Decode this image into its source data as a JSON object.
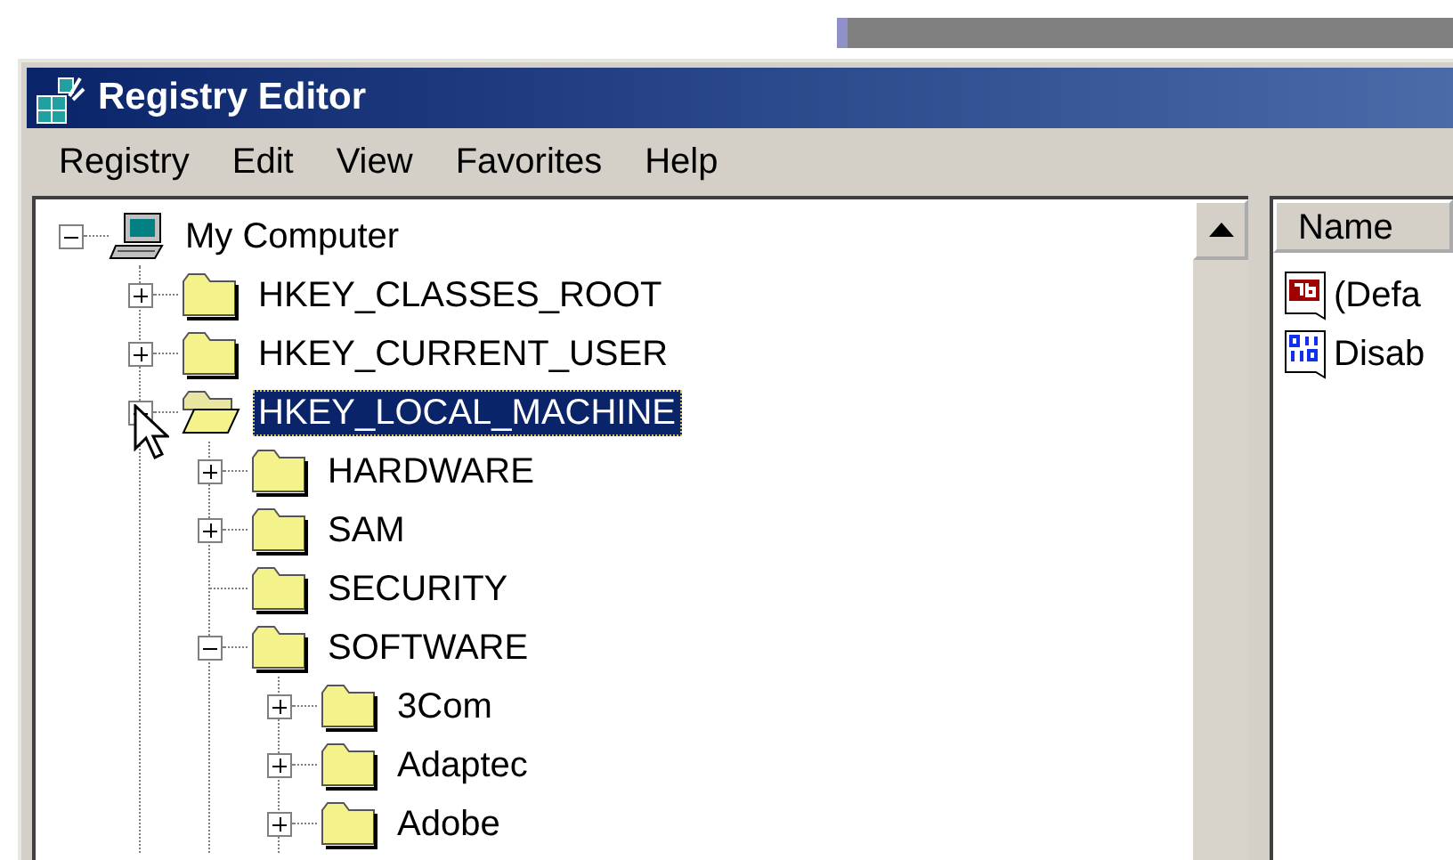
{
  "window": {
    "title": "Registry Editor"
  },
  "menu": [
    "Registry",
    "Edit",
    "View",
    "Favorites",
    "Help"
  ],
  "tree": {
    "nodes": [
      {
        "label": "My Computer",
        "kind": "computer",
        "expanded": true,
        "selected": false,
        "children": [
          {
            "label": "HKEY_CLASSES_ROOT",
            "kind": "folder",
            "expanded": false,
            "selected": false
          },
          {
            "label": "HKEY_CURRENT_USER",
            "kind": "folder",
            "expanded": false,
            "selected": false
          },
          {
            "label": "HKEY_LOCAL_MACHINE",
            "kind": "folder",
            "expanded": true,
            "selected": true,
            "children": [
              {
                "label": "HARDWARE",
                "kind": "folder",
                "expanded": false,
                "selected": false
              },
              {
                "label": "SAM",
                "kind": "folder",
                "expanded": false,
                "selected": false
              },
              {
                "label": "SECURITY",
                "kind": "folder",
                "selected": false
              },
              {
                "label": "SOFTWARE",
                "kind": "folder",
                "expanded": true,
                "selected": false,
                "children": [
                  {
                    "label": "3Com",
                    "kind": "folder",
                    "expanded": false,
                    "selected": false
                  },
                  {
                    "label": "Adaptec",
                    "kind": "folder",
                    "expanded": false,
                    "selected": false
                  },
                  {
                    "label": "Adobe",
                    "kind": "folder",
                    "expanded": false,
                    "selected": false
                  }
                ]
              }
            ]
          }
        ]
      }
    ]
  },
  "list": {
    "columns": [
      "Name"
    ],
    "rows": [
      {
        "name": "(Defa",
        "kind": "string"
      },
      {
        "name": "Disab",
        "kind": "binary"
      }
    ]
  }
}
